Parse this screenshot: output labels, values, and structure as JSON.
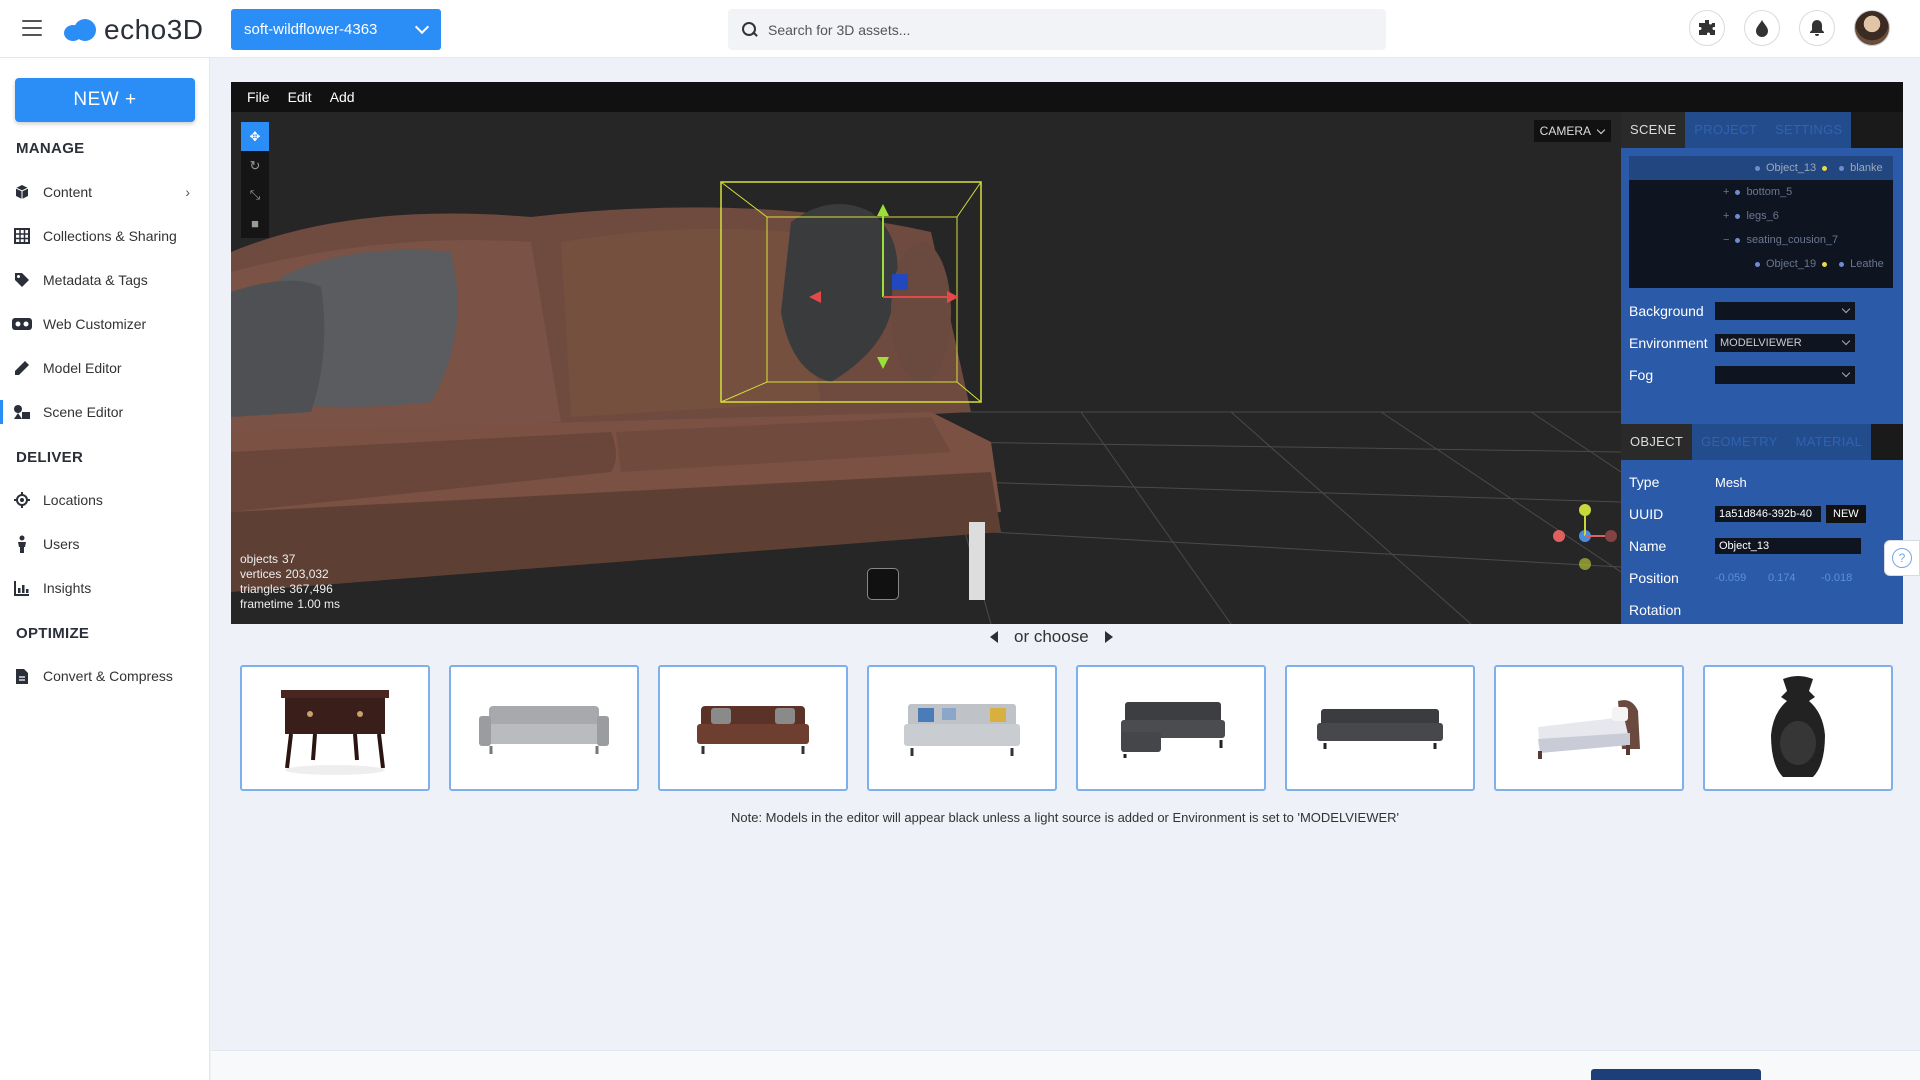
{
  "header": {
    "logo_text": "echo3D",
    "project_name": "soft-wildflower-4363",
    "search_placeholder": "Search for 3D assets...",
    "icons": [
      "puzzle-icon",
      "drop-icon",
      "bell-icon",
      "avatar"
    ]
  },
  "sidebar": {
    "new_label": "NEW +",
    "sections": {
      "manage": "MANAGE",
      "deliver": "DELIVER",
      "optimize": "OPTIMIZE"
    },
    "items": [
      {
        "label": "Content",
        "icon": "cube-icon"
      },
      {
        "label": "Collections & Sharing",
        "icon": "grid-icon"
      },
      {
        "label": "Metadata & Tags",
        "icon": "tag-icon"
      },
      {
        "label": "Web Customizer",
        "icon": "vr-icon"
      },
      {
        "label": "Model Editor",
        "icon": "pencil-icon"
      },
      {
        "label": "Scene Editor",
        "icon": "shapes-icon"
      },
      {
        "label": "Locations",
        "icon": "location-icon"
      },
      {
        "label": "Users",
        "icon": "person-icon"
      },
      {
        "label": "Insights",
        "icon": "chart-icon"
      },
      {
        "label": "Convert & Compress",
        "icon": "file-icon"
      }
    ]
  },
  "editor": {
    "menu": [
      "File",
      "Edit",
      "Add"
    ],
    "camera_label": "CAMERA",
    "stats": [
      {
        "label": "objects",
        "value": "37"
      },
      {
        "label": "vertices",
        "value": "203,032"
      },
      {
        "label": "triangles",
        "value": "367,496"
      },
      {
        "label": "frametime",
        "value": "1.00 ms"
      }
    ],
    "panel_tabs": [
      "SCENE",
      "PROJECT",
      "SETTINGS"
    ],
    "outliner": [
      {
        "name": "Object_13",
        "extra": "blanke"
      },
      {
        "name": "bottom_5",
        "extra": ""
      },
      {
        "name": "legs_6",
        "extra": ""
      },
      {
        "name": "seating_cousion_7",
        "extra": ""
      },
      {
        "name": "Object_19",
        "extra": "Leathe"
      }
    ],
    "scene_props": {
      "background_label": "Background",
      "background_value": "",
      "environment_label": "Environment",
      "environment_value": "MODELVIEWER",
      "fog_label": "Fog",
      "fog_value": ""
    },
    "object_tabs": [
      "OBJECT",
      "GEOMETRY",
      "MATERIAL"
    ],
    "object": {
      "type_label": "Type",
      "type_value": "Mesh",
      "uuid_label": "UUID",
      "uuid_value": "1a51d846-392b-40",
      "uuid_new": "NEW",
      "name_label": "Name",
      "name_value": "Object_13",
      "position_label": "Position",
      "position": [
        "-0.059",
        "0.174",
        "-0.018"
      ],
      "rotation_label": "Rotation"
    }
  },
  "chooser": {
    "label": "or choose",
    "thumbnails": [
      "dresser",
      "grey-sofa",
      "brown-sofa",
      "patterned-sofa",
      "sectional-sofa",
      "dark-sofa",
      "bed",
      "vase"
    ]
  },
  "note": "Note: Models in the editor will appear black unless a light source is added or Environment is set to 'MODELVIEWER'",
  "colors": {
    "accent": "#2b8df6",
    "panel": "#2a5aa8",
    "editor_bg": "#262626"
  }
}
